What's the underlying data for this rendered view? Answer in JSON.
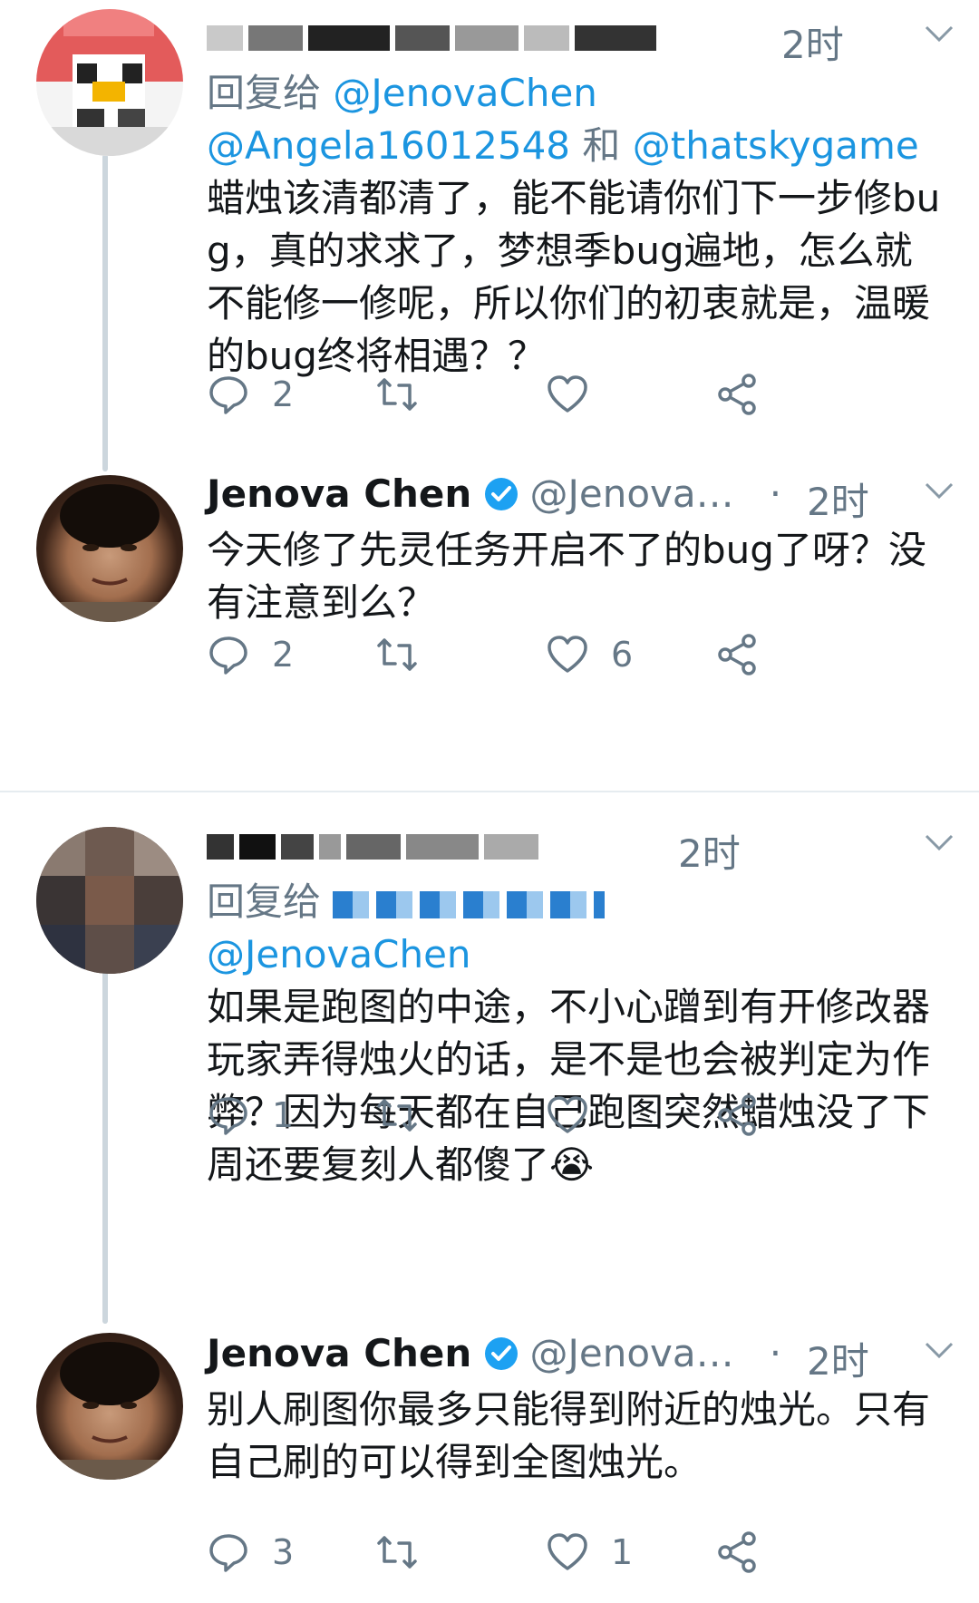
{
  "tweets": [
    {
      "time": "2时",
      "reply_label": "回复给",
      "mentions": [
        "@JenovaChen",
        "@Angela16012548",
        "和",
        "@thatskygame"
      ],
      "text": "蜡烛该清都清了，能不能请你们下一步修bug，真的求求了，梦想季bug遍地，怎么就不能修一修呢，所以你们的初衷就是，温暖的bug终将相遇？？",
      "reply_count": "2",
      "retweet_count": "",
      "like_count": ""
    },
    {
      "name": "Jenova Chen",
      "handle": "@Jenova…",
      "dot": "·",
      "time": "2时",
      "text": "今天修了先灵任务开启不了的bug了呀？没有注意到么？",
      "reply_count": "2",
      "retweet_count": "",
      "like_count": "6"
    },
    {
      "time": "2时",
      "reply_label": "回复给",
      "mentions": [
        "@JenovaChen"
      ],
      "text": "如果是跑图的中途，不小心蹭到有开修改器玩家弄得烛火的话，是不是也会被判定为作弊？因为每天都在自己跑图突然蜡烛没了下周还要复刻人都傻了😭",
      "reply_count": "1",
      "retweet_count": "",
      "like_count": ""
    },
    {
      "name": "Jenova Chen",
      "handle": "@Jenova…",
      "dot": "·",
      "time": "2时",
      "text": "别人刷图你最多只能得到附近的烛光。只有自己刷的可以得到全图烛光。",
      "reply_count": "3",
      "retweet_count": "",
      "like_count": "1"
    }
  ],
  "colors": {
    "link": "#1b95e0",
    "secondary_text": "#657786",
    "verified": "#1da1f2",
    "thread_line": "#ccd6dd",
    "divider": "#e6ecf0"
  },
  "icons": [
    "reply-icon",
    "retweet-icon",
    "like-icon",
    "share-icon",
    "verified-badge-icon",
    "chevron-down-icon"
  ]
}
